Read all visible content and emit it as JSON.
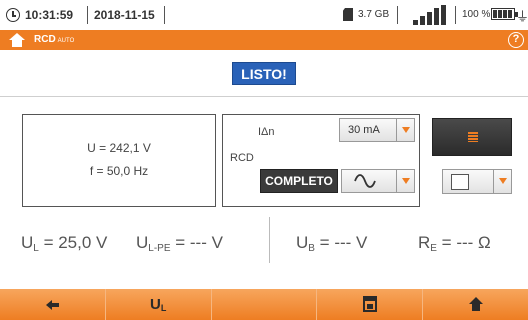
{
  "status_bar": {
    "time": "10:31:59",
    "date": "2018-11-15",
    "storage": "3.7 GB",
    "battery_percent": "100 %",
    "signal_bars": 5,
    "icons": [
      "clock-icon",
      "sd-card-icon",
      "signal-icon",
      "battery-icon",
      "plug-icon"
    ]
  },
  "title_bar": {
    "mode_label": "RCD",
    "mode_suffix": "AUTO",
    "accent_color": "#ee7d22",
    "icons": [
      "home-icon",
      "help-icon"
    ]
  },
  "status_badge": {
    "text": "LISTO!",
    "color": "#2a62b8"
  },
  "info_panel": {
    "voltage": "U = 242,1 V",
    "frequency": "f = 50,0 Hz"
  },
  "settings": {
    "i_delta_label": "IΔn",
    "rcd_label": "RCD",
    "current_value": "30 mA",
    "complete_button": "COMPLETO",
    "waveform_value": "sine-wave-icon",
    "list_button_icon": "list-icon",
    "checkbox_checked": false
  },
  "results": {
    "ul_prefix": "U",
    "ul_sub": "L",
    "ul_value": " = 25,0 V",
    "ulpe_prefix": "U",
    "ulpe_sub": "L-PE",
    "ulpe_value": " = --- V",
    "ub_prefix": "U",
    "ub_sub": "B",
    "ub_value": " = --- V",
    "re_prefix": "R",
    "re_sub": "E",
    "re_value": " = --- Ω"
  },
  "toolbar": {
    "ul_button_main": "U",
    "ul_button_sub": "L",
    "icons": [
      "back-arrow-icon",
      "save-memory-icon",
      "home-icon"
    ]
  }
}
